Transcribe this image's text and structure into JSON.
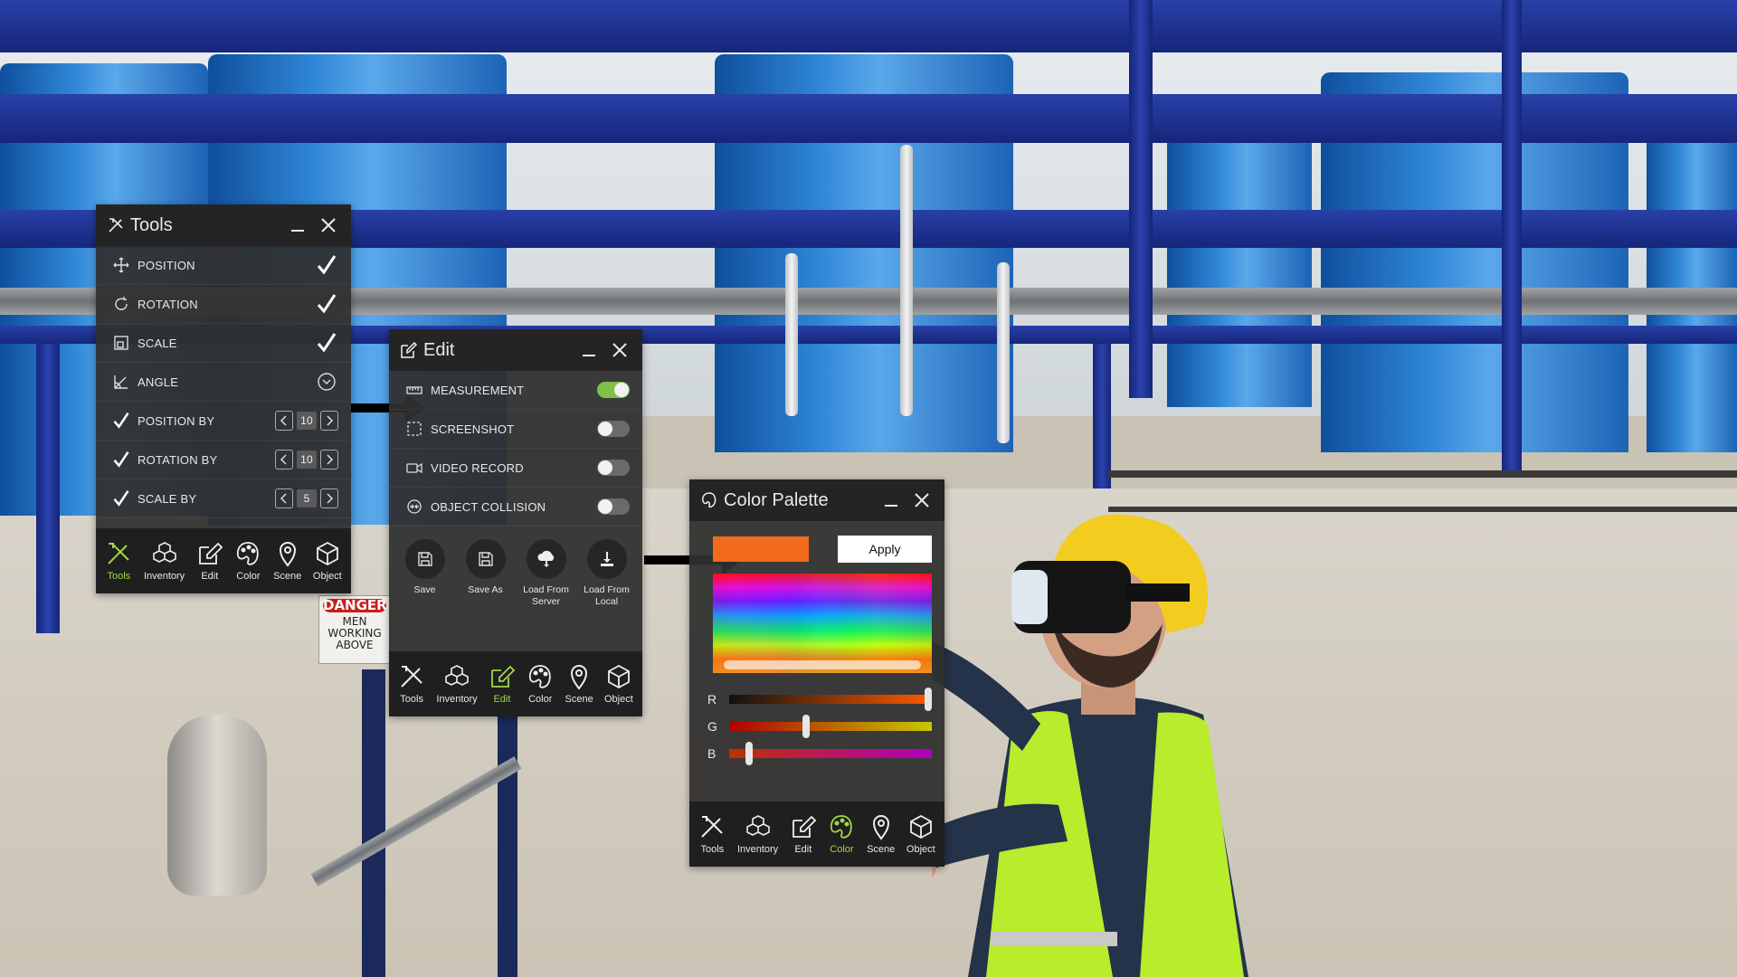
{
  "tools_panel": {
    "title": "Tools",
    "rows": [
      {
        "label": "POSITION"
      },
      {
        "label": "ROTATION"
      },
      {
        "label": "SCALE"
      },
      {
        "label": "ANGLE"
      },
      {
        "label": "POSITION BY",
        "value": "10"
      },
      {
        "label": "ROTATION BY",
        "value": "10"
      },
      {
        "label": "SCALE BY",
        "value": "5"
      }
    ]
  },
  "edit_panel": {
    "title": "Edit",
    "toggles": [
      {
        "label": "MEASUREMENT",
        "on": true
      },
      {
        "label": "SCREENSHOT",
        "on": false
      },
      {
        "label": "VIDEO RECORD",
        "on": false
      },
      {
        "label": "OBJECT COLLISION",
        "on": false
      }
    ],
    "file_buttons": [
      {
        "label": "Save"
      },
      {
        "label": "Save As"
      },
      {
        "label": "Load From Server"
      },
      {
        "label": "Load From Local"
      }
    ]
  },
  "color_panel": {
    "title": "Color Palette",
    "swatch_color": "#f26a1b",
    "apply_label": "Apply",
    "channels": [
      {
        "label": "R",
        "level": 0.98
      },
      {
        "label": "G",
        "level": 0.38
      },
      {
        "label": "B",
        "level": 0.1
      }
    ]
  },
  "nav": {
    "items": [
      "Tools",
      "Inventory",
      "Edit",
      "Color",
      "Scene",
      "Object"
    ]
  },
  "scene": {
    "sign_title": "DANGER",
    "sign_text": "MEN WORKING ABOVE"
  },
  "colors": {
    "accent_green": "#9fd84a",
    "toggle_on": "#7ec245",
    "panel_bg": "#303030"
  }
}
